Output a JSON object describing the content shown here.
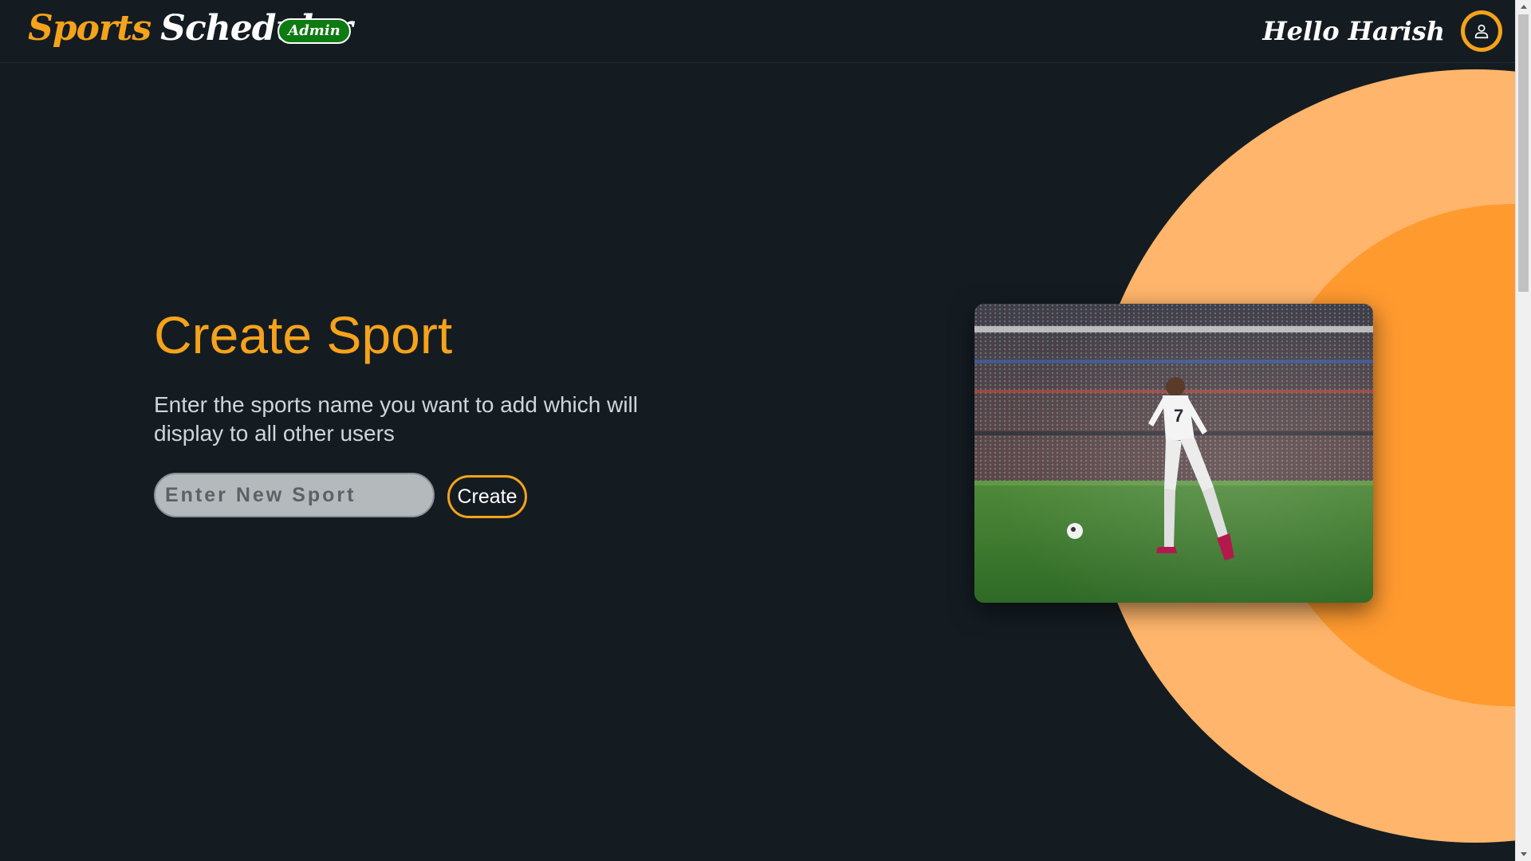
{
  "header": {
    "brand_word_1": "Sports",
    "brand_word_2": "Scheduler",
    "badge": "Admin",
    "greeting": "Hello Harish",
    "avatar_icon": "user-icon"
  },
  "main": {
    "title": "Create Sport",
    "description": "Enter the sports name you want to add which will display to all other users",
    "input_placeholder": "Enter New Sport",
    "input_value": "",
    "create_button": "Create"
  },
  "hero_image": {
    "subject": "soccer-player-in-stadium"
  },
  "colors": {
    "background": "#141c22",
    "accent": "#f5a21c",
    "badge_green": "#0e7a12",
    "circle_light": "#ffb56b",
    "circle_dark": "#ff9a2f"
  }
}
